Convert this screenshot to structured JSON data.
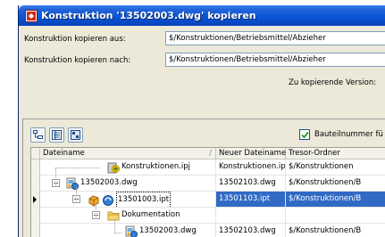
{
  "window": {
    "title": "Konstruktion '13502003.dwg' kopieren"
  },
  "form": {
    "source_label": "Konstruktion kopieren aus:",
    "source_value": "$/Konstruktionen/Betriebsmittel/Abzieher",
    "target_label": "Konstruktion kopieren nach:",
    "target_value": "$/Konstruktionen/Betriebsmittel/Abzieher",
    "version_label": "Zu kopierende Version:"
  },
  "toolbar": {
    "checkbox_label": "Bauteilnummer fü",
    "checkbox_checked": true
  },
  "table": {
    "columns": [
      "Dateiname",
      "Neuer Dateiname",
      "Tresor-Ordner"
    ],
    "rows": [
      {
        "name": "Konstruktionen.ipj",
        "new_name": "Konstruktionen.ipj",
        "folder": "$/Konstruktionen",
        "icon": "project-file-icon"
      },
      {
        "name": "13502003.dwg",
        "new_name": "13502103.dwg",
        "folder": "$/Konstruktionen/B",
        "icon": "drawing-file-icon"
      },
      {
        "name": "13501003.ipt",
        "new_name": "13501103.ipt",
        "folder": "$/Konstruktionen/B",
        "icon": "part-file-icon",
        "selected": true
      },
      {
        "name": "Dokumentation",
        "new_name": "",
        "folder": "",
        "icon": "folder-icon"
      },
      {
        "name": "13502003.dwg",
        "new_name": "13502103.dwg",
        "folder": "$/Konstruktionen/B",
        "icon": "drawing-file-icon"
      }
    ]
  },
  "colors": {
    "titlebar": "#0a55d8",
    "selection": "#316ac5",
    "dialog_bg": "#ece9d8"
  }
}
